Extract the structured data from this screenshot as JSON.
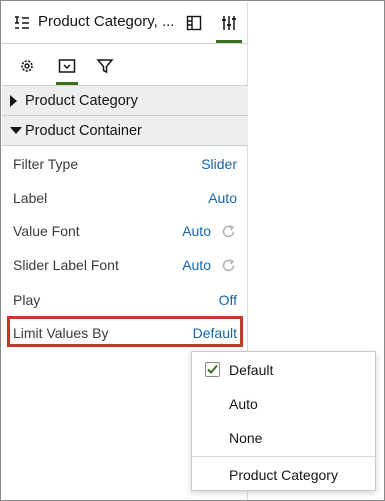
{
  "header": {
    "title": "Product Category, ...",
    "icons": [
      "filter-list-icon",
      "layout-panel-icon",
      "sliders-icon"
    ]
  },
  "tabs": {
    "icons": [
      "gear-icon",
      "visualization-icon",
      "filter-icon"
    ],
    "active": "visualization-icon"
  },
  "sections": {
    "collapsed_label": "Product Category",
    "expanded_label": "Product Container"
  },
  "properties": [
    {
      "label": "Filter Type",
      "value": "Slider",
      "reset": false
    },
    {
      "label": "Label",
      "value": "Auto",
      "reset": false
    },
    {
      "label": "Value Font",
      "value": "Auto",
      "reset": true
    },
    {
      "label": "Slider Label Font",
      "value": "Auto",
      "reset": true
    },
    {
      "label": "Play",
      "value": "Off",
      "reset": false
    },
    {
      "label": "Limit Values By",
      "value": "Default",
      "reset": false
    }
  ],
  "dropdown": {
    "options": [
      {
        "label": "Default",
        "checked": true
      },
      {
        "label": "Auto",
        "checked": false
      },
      {
        "label": "None",
        "checked": false
      },
      {
        "label": "Product Category",
        "checked": false
      }
    ]
  },
  "colors": {
    "link": "#1565a8",
    "accent": "#3a6f1e",
    "highlight": "#c0392b",
    "check": "#3a6f1e"
  }
}
